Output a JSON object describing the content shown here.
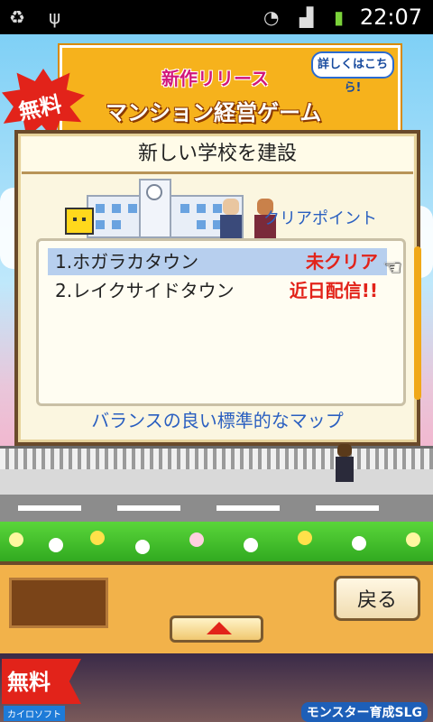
{
  "status_bar": {
    "time": "22:07",
    "icons": [
      "recycle-icon",
      "usb-icon",
      "wifi-icon",
      "signal-icon",
      "battery-icon"
    ]
  },
  "banner": {
    "badge": "無料",
    "line1": "新作リリース",
    "line2": "マンション経営ゲーム",
    "bubble": "詳しくはこちら!"
  },
  "dialog": {
    "title": "新しい学校を建設",
    "clear_points_label": "クリアポイント",
    "maps": [
      {
        "name": "1.ホガラカタウン",
        "status": "未クリア",
        "selected": true
      },
      {
        "name": "2.レイクサイドタウン",
        "status": "近日配信!!",
        "selected": false
      }
    ],
    "description": "バランスの良い標準的なマップ"
  },
  "bottom_panel": {
    "back_label": "戻る"
  },
  "ad": {
    "badge": "無料",
    "maker": "カイロソフト",
    "genre": "モンスター育成SLG"
  },
  "colors": {
    "accent_red": "#e2231a",
    "dialog_bg": "#fbf6e0",
    "selection": "#b7cfee",
    "label_blue": "#2a5fc0"
  }
}
